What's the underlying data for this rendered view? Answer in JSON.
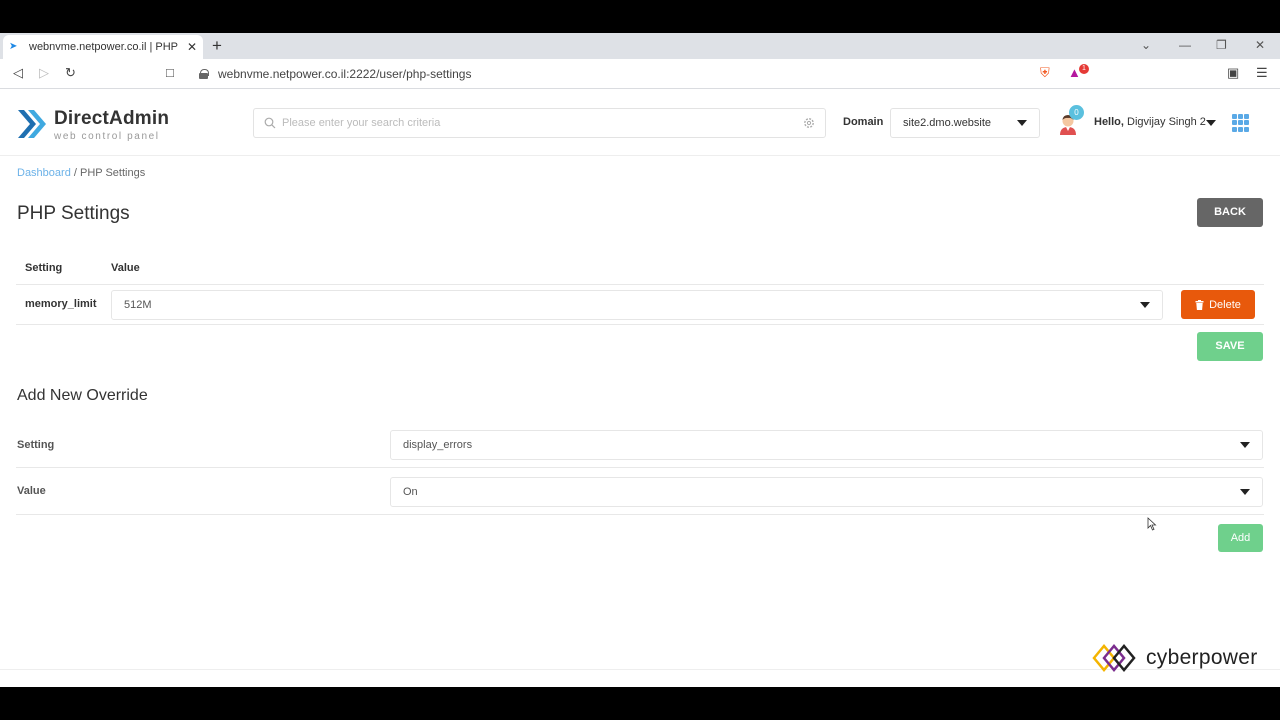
{
  "browser": {
    "tab_title": "webnvme.netpower.co.il | PHP Se",
    "url": "webnvme.netpower.co.il:2222/user/php-settings",
    "ext_badge": "1"
  },
  "header": {
    "logo_name": "DirectAdmin",
    "logo_sub": "web control panel",
    "search_placeholder": "Please enter your search criteria",
    "domain_label": "Domain",
    "domain_value": "site2.dmo.website",
    "notification_count": "0",
    "hello_prefix": "Hello,",
    "user_name": "Digvijay Singh 2"
  },
  "breadcrumb": {
    "dashboard": "Dashboard",
    "separator": " / ",
    "current": "PHP Settings"
  },
  "page": {
    "title": "PHP Settings",
    "back_label": "BACK",
    "table": {
      "headers": [
        "Setting",
        "Value"
      ],
      "rows": [
        {
          "setting": "memory_limit",
          "value": "512M",
          "delete_label": "Delete"
        }
      ]
    },
    "save_label": "SAVE",
    "add_section": {
      "title": "Add New Override",
      "setting_label": "Setting",
      "setting_value": "display_errors",
      "value_label": "Value",
      "value_value": "On",
      "add_label": "Add"
    }
  },
  "watermark": {
    "text": "cyberpower"
  },
  "colors": {
    "accent": "#5aa9e6",
    "delete": "#e8590c",
    "save": "#6fd08c",
    "back": "#666666"
  }
}
